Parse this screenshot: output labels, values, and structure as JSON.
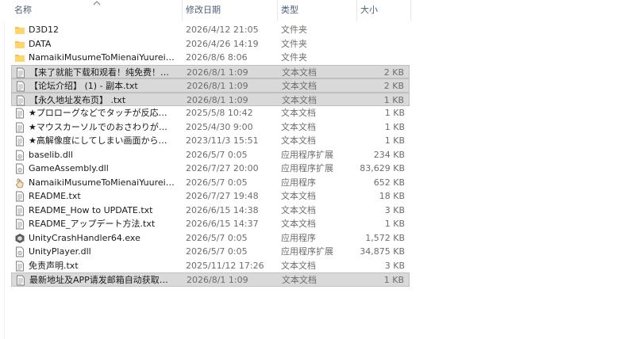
{
  "columns": {
    "name": "名称",
    "date": "修改日期",
    "type": "类型",
    "size": "大小"
  },
  "files": [
    {
      "name": "D3D12",
      "date": "2026/4/12 21:05",
      "type": "文件夹",
      "size": "",
      "icon": "folder-icon",
      "selected": false
    },
    {
      "name": "DATA",
      "date": "2026/4/26 14:19",
      "type": "文件夹",
      "size": "",
      "icon": "folder-icon",
      "selected": false
    },
    {
      "name": "NamaikiMusumeToMienaiYuurei_Data",
      "date": "2026/8/6 8:06",
      "type": "文件夹",
      "size": "",
      "icon": "folder-icon",
      "selected": false
    },
    {
      "name": "【来了就能下载和观看！纯免费！】- 副...",
      "date": "2026/8/1 1:09",
      "type": "文本文档",
      "size": "2 KB",
      "icon": "text-file-icon",
      "selected": true
    },
    {
      "name": "【论坛介绍】 (1) - 副本.txt",
      "date": "2026/8/1 1:09",
      "type": "文本文档",
      "size": "2 KB",
      "icon": "text-file-icon",
      "selected": true
    },
    {
      "name": "【永久地址发布页】 .txt",
      "date": "2026/8/1 1:09",
      "type": "文本文档",
      "size": "1 KB",
      "icon": "text-file-icon",
      "selected": true
    },
    {
      "name": "★プロローグなどでタッチが反応しない...",
      "date": "2025/5/8 10:42",
      "type": "文本文档",
      "size": "1 KB",
      "icon": "text-file-icon",
      "selected": false
    },
    {
      "name": "★マウスカーソルでのおさわりが反応し...",
      "date": "2025/4/30 9:00",
      "type": "文本文档",
      "size": "1 KB",
      "icon": "text-file-icon",
      "selected": false
    },
    {
      "name": "★高解像度にしてしまい画面からはみ出...",
      "date": "2023/11/3 15:51",
      "type": "文本文档",
      "size": "1 KB",
      "icon": "text-file-icon",
      "selected": false
    },
    {
      "name": "baselib.dll",
      "date": "2026/5/7 0:05",
      "type": "应用程序扩展",
      "size": "234 KB",
      "icon": "dll-file-icon",
      "selected": false
    },
    {
      "name": "GameAssembly.dll",
      "date": "2026/7/27 20:00",
      "type": "应用程序扩展",
      "size": "83,629 KB",
      "icon": "dll-file-icon",
      "selected": false
    },
    {
      "name": "NamaikiMusumeToMienaiYuurei.exe",
      "date": "2026/5/7 0:05",
      "type": "应用程序",
      "size": "652 KB",
      "icon": "exe-app-icon",
      "selected": false
    },
    {
      "name": "README.txt",
      "date": "2026/7/27 19:48",
      "type": "文本文档",
      "size": "18 KB",
      "icon": "text-file-icon",
      "selected": false
    },
    {
      "name": "README_How to UPDATE.txt",
      "date": "2026/6/15 14:38",
      "type": "文本文档",
      "size": "3 KB",
      "icon": "text-file-icon",
      "selected": false
    },
    {
      "name": "README_アップデート方法.txt",
      "date": "2026/6/15 14:37",
      "type": "文本文档",
      "size": "1 KB",
      "icon": "text-file-icon",
      "selected": false
    },
    {
      "name": "UnityCrashHandler64.exe",
      "date": "2026/5/7 0:05",
      "type": "应用程序",
      "size": "1,572 KB",
      "icon": "unity-exe-icon",
      "selected": false
    },
    {
      "name": "UnityPlayer.dll",
      "date": "2026/5/7 0:05",
      "type": "应用程序扩展",
      "size": "34,875 KB",
      "icon": "dll-file-icon",
      "selected": false
    },
    {
      "name": "免责声明.txt",
      "date": "2025/11/12 17:26",
      "type": "文本文档",
      "size": "3 KB",
      "icon": "text-file-icon",
      "selected": false
    },
    {
      "name": "最新地址及APP请发邮箱自动获取！！！...",
      "date": "2026/8/1 1:09",
      "type": "文本文档",
      "size": "1 KB",
      "icon": "text-file-icon",
      "selected": true
    }
  ]
}
